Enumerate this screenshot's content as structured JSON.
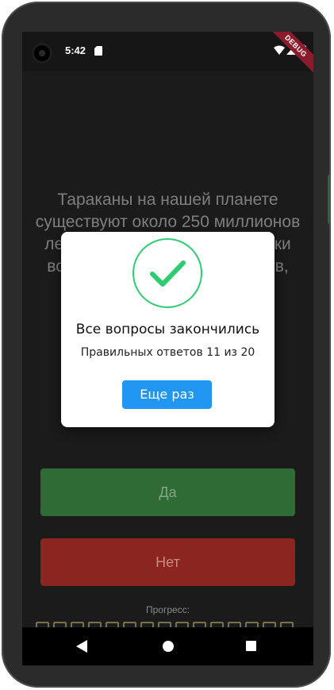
{
  "status_bar": {
    "time": "5:42",
    "debug_label": "DEBUG",
    "icons": [
      "sd-card-icon",
      "wifi-icon",
      "signal-icon",
      "battery-icon"
    ]
  },
  "quiz": {
    "question": "Тараканы на нашей планете существуют около 250 миллионов лет и пережили бы практически всю эволюцию живых существ, несмотря на катаклизмы",
    "yes_label": "Да",
    "no_label": "Нет",
    "progress_label": "Прогресс:",
    "progress_total": 20,
    "colors": {
      "yes": "#2f6b35",
      "no": "#8b2520",
      "progress_border": "#77724c"
    }
  },
  "dialog": {
    "icon": "check-circle-icon",
    "title": "Все вопросы закончились",
    "description": "Правильных ответов 11 из 20",
    "retry_label": "Еще раз",
    "colors": {
      "accent": "#2196f3",
      "check": "#2ecc71"
    }
  },
  "nav_bar": {
    "icons": [
      "back-icon",
      "home-icon",
      "recents-icon"
    ]
  }
}
